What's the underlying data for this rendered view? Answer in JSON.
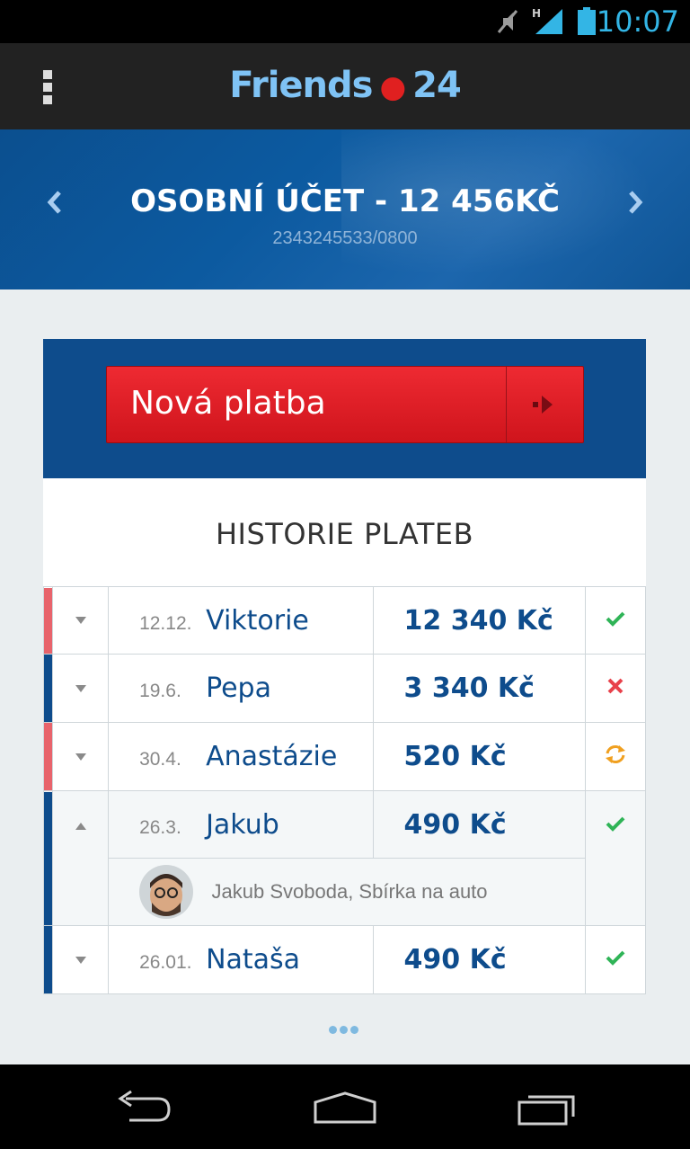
{
  "status_bar": {
    "time": "10:07",
    "icons": [
      "mute-icon",
      "signal-icon",
      "battery-icon"
    ]
  },
  "app_bar": {
    "title_left": "Friends",
    "title_right": "24",
    "menu_icon": "overflow-menu-icon"
  },
  "account": {
    "title": "OSOBNÍ ÚČET - 12 456KČ",
    "number": "2343245533/0800"
  },
  "new_payment": {
    "label": "Nová platba"
  },
  "history": {
    "title": "HISTORIE PLATEB",
    "rows": [
      {
        "date": "12.12.",
        "name": "Viktorie",
        "amount": "12 340 Kč",
        "status": "success",
        "bar_color": "#e8636b"
      },
      {
        "date": "19.6.",
        "name": "Pepa",
        "amount": "3 340 Kč",
        "status": "failed",
        "bar_color": "#0e4c8c"
      },
      {
        "date": "30.4.",
        "name": "Anastázie",
        "amount": "520 Kč",
        "status": "pending",
        "bar_color": "#e8636b"
      },
      {
        "date": "26.3.",
        "name": "Jakub",
        "amount": "490 Kč",
        "status": "success",
        "bar_color": "#0e4c8c",
        "detail": "Jakub Svoboda, Sbírka na auto"
      },
      {
        "date": "26.01.",
        "name": "Nataša",
        "amount": "490 Kč",
        "status": "success",
        "bar_color": "#0e4c8c"
      }
    ]
  },
  "colors": {
    "brand_blue": "#0e4c8c",
    "accent_red": "#e02020",
    "success": "#2fb457",
    "failed": "#e8414b",
    "pending": "#f0a020"
  }
}
